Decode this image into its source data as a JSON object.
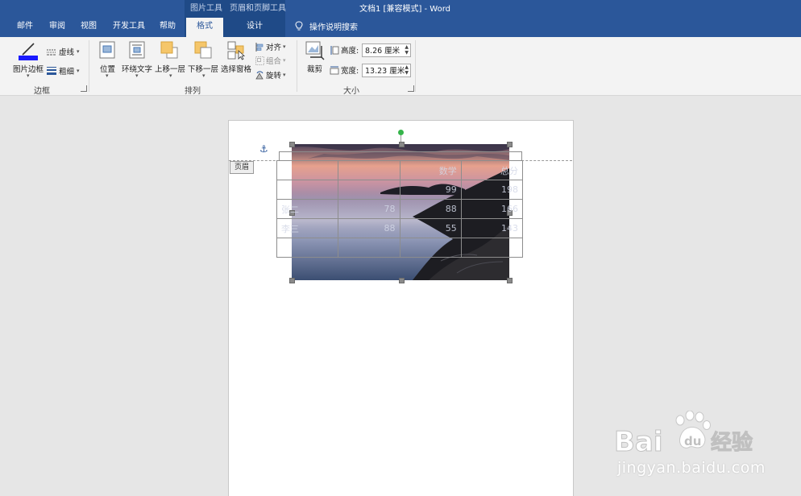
{
  "window": {
    "title": "文档1 [兼容模式] - Word",
    "context_tools": [
      "图片工具",
      "页眉和页脚工具"
    ]
  },
  "tabs": [
    "邮件",
    "审阅",
    "视图",
    "开发工具",
    "帮助",
    "格式",
    "设计"
  ],
  "tell_me": {
    "label": "操作说明搜索",
    "icon": "lightbulb-icon"
  },
  "ribbon": {
    "border_group": {
      "label": "边框",
      "picture_border": "图片边框",
      "dashes": "虚线",
      "weight": "粗细",
      "border_color": "#1a1aff"
    },
    "arrange_group": {
      "label": "排列",
      "position": "位置",
      "wrap_text": "环绕文字",
      "bring_forward": "上移一层",
      "send_backward": "下移一层",
      "selection_pane": "选择窗格",
      "align": "对齐",
      "group": "组合",
      "rotate": "旋转"
    },
    "size_group": {
      "label": "大小",
      "crop": "裁剪",
      "height_label": "高度:",
      "height_value": "8.26 厘米",
      "width_label": "宽度:",
      "width_value": "13.23 厘米"
    }
  },
  "document": {
    "header_tag": "页眉",
    "table": [
      [
        "",
        "",
        "数学",
        "总分"
      ],
      [
        "",
        "",
        "99",
        "198"
      ],
      [
        "张二",
        "78",
        "88",
        "166"
      ],
      [
        "李三",
        "88",
        "55",
        "143"
      ],
      [
        "",
        "",
        "",
        ""
      ]
    ]
  },
  "watermark": {
    "logo_text": "Bai du 经验",
    "url": "jingyan.baidu.com"
  },
  "colors": {
    "title_bar": "#2b579a",
    "ribbon_bg": "#f3f3f3",
    "canvas_bg": "#e6e6e6",
    "rotate_handle": "#35b44a"
  }
}
